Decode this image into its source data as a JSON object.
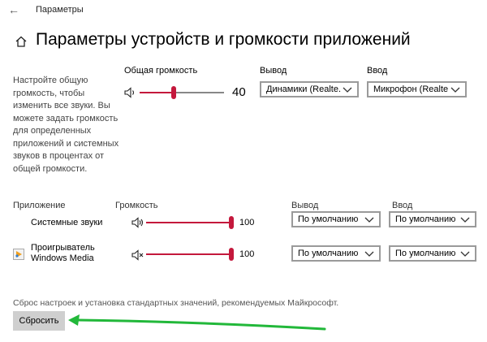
{
  "window": {
    "title": "Параметры"
  },
  "page": {
    "title": "Параметры устройств и громкости приложений"
  },
  "master": {
    "description": "Настройте общую громкость, чтобы изменить все звуки. Вы можете задать громкость для определенных приложений и системных звуков в процентах от общей громкости.",
    "volume_label": "Общая громкость",
    "volume_value": "40",
    "output_label": "Вывод",
    "output_value": "Динамики (Realte...",
    "input_label": "Ввод",
    "input_value": "Микрофон (Realte..."
  },
  "apps_header": {
    "app": "Приложение",
    "volume": "Громкость",
    "output": "Вывод",
    "input": "Ввод"
  },
  "apps": [
    {
      "name": "Системные звуки",
      "volume": "100",
      "output": "По умолчанию",
      "input": "По умолчанию"
    },
    {
      "name": "Проигрыватель Windows Media",
      "volume": "100",
      "output": "По умолчанию",
      "input": "По умолчанию"
    }
  ],
  "reset": {
    "description": "Сброс настроек и установка стандартных значений, рекомендуемых Майкрософт.",
    "button_label": "Сбросить"
  },
  "colors": {
    "accent": "#c4183c",
    "annotation_arrow": "#22b83a"
  }
}
